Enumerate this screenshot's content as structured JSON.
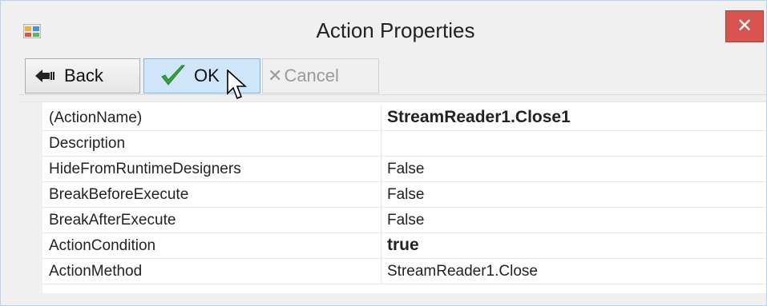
{
  "window": {
    "title": "Action Properties",
    "close_glyph": "✕",
    "accent_color": "#d9534f"
  },
  "toolbar": {
    "back_label": "Back",
    "ok_label": "OK",
    "cancel_label": "Cancel",
    "cancel_enabled": false
  },
  "properties": {
    "rows": [
      {
        "name": "(ActionName)",
        "value": "StreamReader1.Close1",
        "bold": true
      },
      {
        "name": "Description",
        "value": "",
        "bold": false
      },
      {
        "name": "HideFromRuntimeDesigners",
        "value": "False",
        "bold": false
      },
      {
        "name": "BreakBeforeExecute",
        "value": "False",
        "bold": false
      },
      {
        "name": "BreakAfterExecute",
        "value": "False",
        "bold": false
      },
      {
        "name": "ActionCondition",
        "value": "true",
        "bold": true
      },
      {
        "name": "ActionMethod",
        "value": "StreamReader1.Close",
        "bold": false
      }
    ]
  }
}
